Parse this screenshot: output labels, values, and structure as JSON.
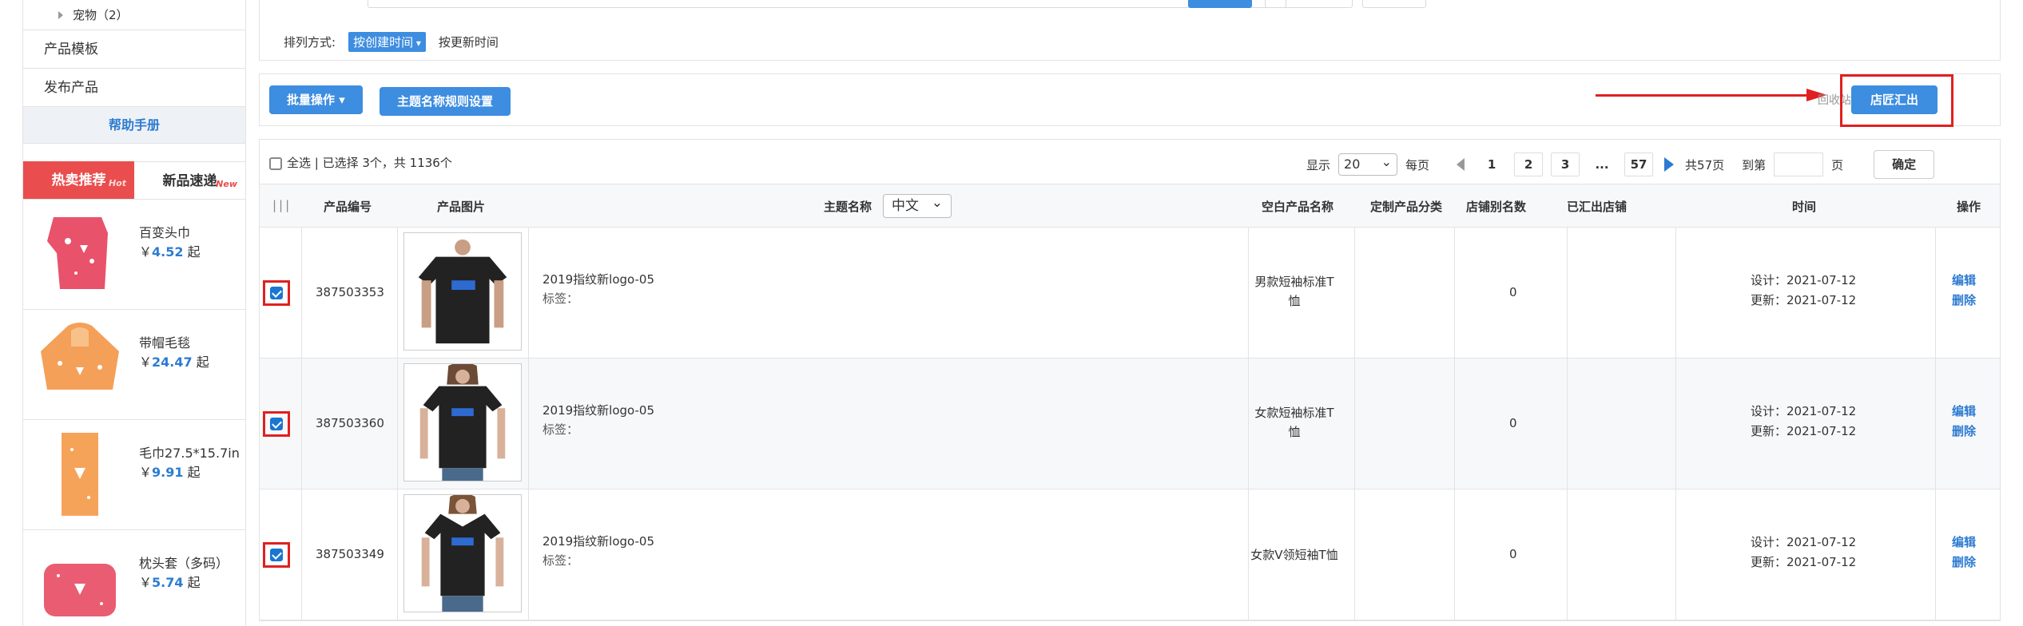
{
  "sidebar": {
    "tree_item": "宠物（2）",
    "links": [
      "产品模板",
      "发布产品"
    ],
    "help": "帮助手册",
    "tabs": [
      {
        "label": "热卖推荐",
        "sup": "Hot"
      },
      {
        "label": "新品速递",
        "sup": "New"
      }
    ],
    "hot_items": [
      {
        "name": "百变头巾",
        "currency": "￥",
        "price": "4.52",
        "suffix": "起",
        "thumb_color": "#e8526a"
      },
      {
        "name": "带帽毛毯",
        "currency": "￥",
        "price": "24.47",
        "suffix": "起",
        "thumb_color": "#f4a058"
      },
      {
        "name": "毛巾27.5*15.7in",
        "currency": "￥",
        "price": "9.91",
        "suffix": "起",
        "thumb_color": "#f6a35a"
      },
      {
        "name": "枕头套（多码）",
        "currency": "￥",
        "price": "5.74",
        "suffix": "起",
        "thumb_color": "#ea5c72"
      }
    ]
  },
  "sort": {
    "label": "排列方式:",
    "active": "按创建时间",
    "other": "按更新时间"
  },
  "actions": {
    "batch": "批量操作",
    "rule": "主题名称规则设置",
    "recycle": "回收站",
    "export": "店匠汇出"
  },
  "pager": {
    "select_all": "全选 | 已选择 3个，共 1136个",
    "show": "显示",
    "per_page_value": "20",
    "per_page": "每页",
    "pages": [
      "1",
      "2",
      "3",
      "...",
      "57"
    ],
    "total": "共57页",
    "goto": "到第",
    "page_unit": "页",
    "ok": "确定"
  },
  "table": {
    "headers": {
      "grip": "|||",
      "code": "产品编号",
      "image": "产品图片",
      "title": "主题名称",
      "lang": "中文",
      "blank_name": "空白产品名称",
      "category": "定制产品分类",
      "alias": "店铺别名数",
      "exported": "已汇出店铺",
      "time": "时间",
      "ops": "操作"
    },
    "rows": [
      {
        "code": "387503353",
        "title": "2019指纹新logo-05",
        "tags": "标签：",
        "blank_line1": "男款短袖标准T",
        "blank_line2": "恤",
        "count": "0",
        "design": "设计：2021-07-12",
        "update": "更新：2021-07-12",
        "edit": "编辑",
        "delete": "删除"
      },
      {
        "code": "387503360",
        "title": "2019指纹新logo-05",
        "tags": "标签：",
        "blank_line1": "女款短袖标准T",
        "blank_line2": "恤",
        "count": "0",
        "design": "设计：2021-07-12",
        "update": "更新：2021-07-12",
        "edit": "编辑",
        "delete": "删除"
      },
      {
        "code": "387503349",
        "title": "2019指纹新logo-05",
        "tags": "标签：",
        "blank_line1": "女款V领短袖T恤",
        "blank_line2": "",
        "count": "0",
        "design": "设计：2021-07-12",
        "update": "更新：2021-07-12",
        "edit": "编辑",
        "delete": "删除"
      }
    ]
  },
  "colors": {
    "primary": "#3d8de0",
    "hot_tab": "#ea4d4d",
    "highlight": "#e02020",
    "link": "#2d7bd1"
  }
}
